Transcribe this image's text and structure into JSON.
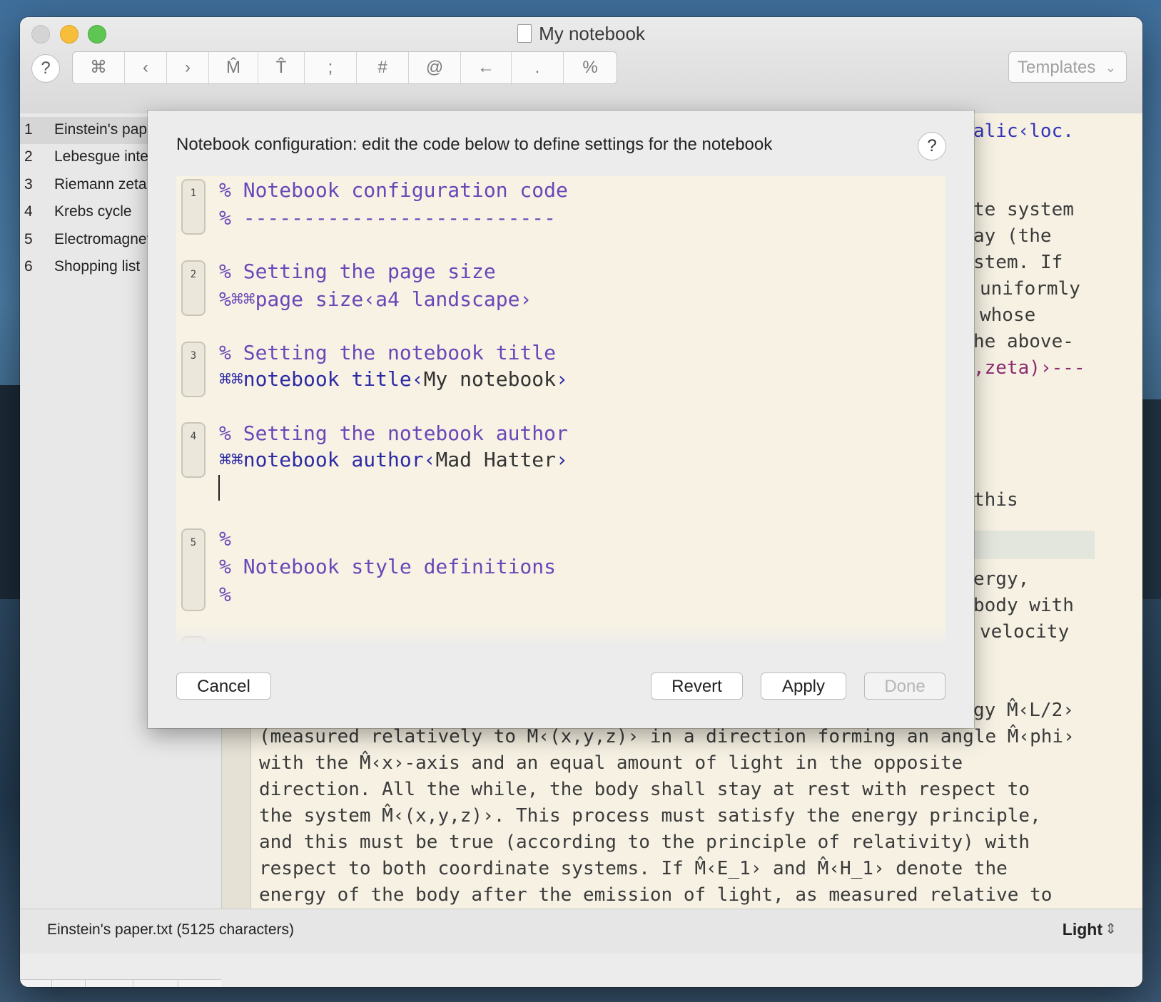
{
  "window": {
    "title": "My notebook"
  },
  "toolbar": {
    "help_label": "?",
    "buttons": [
      "⌘",
      "‹",
      "›",
      "M̂",
      "T̂",
      ";",
      "#",
      "@",
      "←",
      ".",
      "%"
    ],
    "templates_label": "Templates"
  },
  "sidebar": {
    "items": [
      {
        "num": "1",
        "label": "Einstein's paper"
      },
      {
        "num": "2",
        "label": "Lebesgue integration"
      },
      {
        "num": "3",
        "label": "Riemann zeta"
      },
      {
        "num": "4",
        "label": "Krebs cycle"
      },
      {
        "num": "5",
        "label": "Electromagnetism"
      },
      {
        "num": "6",
        "label": "Shopping list"
      }
    ],
    "bottom": {
      "add": "+",
      "remove": "—",
      "grid": "⊞",
      "gear": "⚙"
    }
  },
  "dialog": {
    "title": "Notebook configuration: edit the code below to define settings for the notebook",
    "help_label": "?",
    "cells": [
      {
        "num": "1",
        "lines": [
          "% Notebook configuration code",
          "% --------------------------"
        ]
      },
      {
        "num": "2",
        "lines": [
          "% Setting the page size",
          "%⌘⌘page size‹a4 landscape›"
        ]
      },
      {
        "num": "3",
        "comment": "% Setting the notebook title",
        "command": "⌘⌘notebook title",
        "open": "‹",
        "value": "My notebook",
        "close": "›"
      },
      {
        "num": "4",
        "comment": "% Setting the notebook author",
        "command": "⌘⌘notebook author",
        "open": "‹",
        "value": "Mad Hatter",
        "close": "›"
      },
      {
        "num": "5",
        "lines": [
          "%",
          "% Notebook style definitions",
          "%"
        ]
      }
    ],
    "cancel_label": "Cancel",
    "revert_label": "Revert",
    "apply_label": "Apply",
    "done_label": "Done"
  },
  "editor": {
    "right_fragments": [
      "alic‹loc.",
      "te system",
      "ay (the",
      "stem. If",
      "uniformly",
      "whose",
      "he above-",
      ",zeta)›---",
      "this",
      "ergy,",
      "body with",
      "velocity",
      "gy M̂‹L/2›"
    ],
    "lines": [
      "(measured relatively to M‹(x,y,z)› in a direction forming an angle M̂‹phi›",
      "with the M̂‹x›-axis and an equal amount of light in the opposite",
      "direction. All the while, the body shall stay at rest with respect to",
      "the system M̂‹(x,y,z)›. This process must satisfy the energy principle,",
      "and this must be true (according to the principle of relativity) with",
      "respect to both coordinate systems. If M̂‹E_1› and M̂‹H_1› denote the",
      "energy of the body after the emission of light, as measured relative to"
    ]
  },
  "statusbar": {
    "file_info": "Einstein's paper.txt (5125 characters)",
    "theme": "Light"
  },
  "colors": {
    "comment": "#6a47b8",
    "keyword": "#2d2aa5",
    "paper": "#f7f2e4",
    "traffic_close": "#d4d4d4",
    "traffic_min": "#f6be3b",
    "traffic_max": "#5fc553"
  }
}
